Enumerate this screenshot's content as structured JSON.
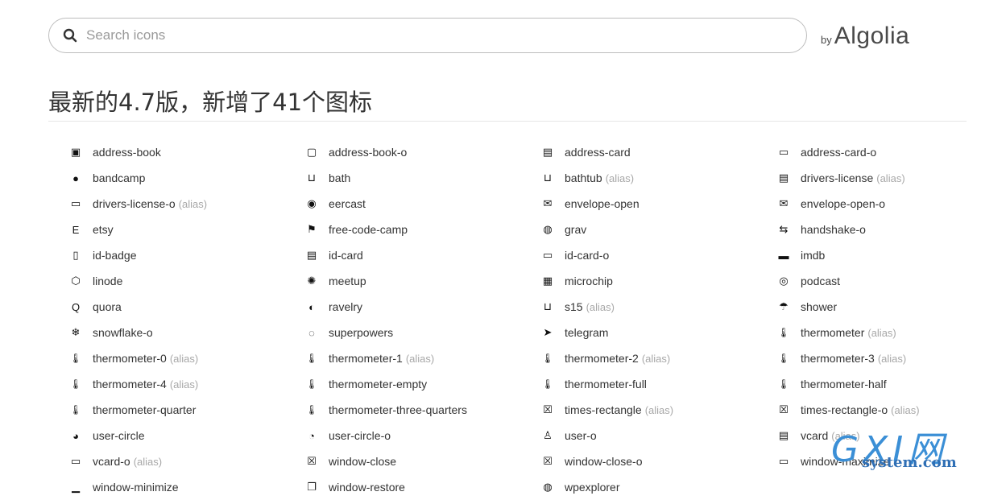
{
  "search": {
    "placeholder": "Search icons"
  },
  "branding": {
    "by": "by",
    "name": "Algolia"
  },
  "heading": "最新的4.7版，新增了41个图标",
  "icons": [
    {
      "name": "address-book",
      "alias": "",
      "icon": "address-book-icon"
    },
    {
      "name": "address-book-o",
      "alias": "",
      "icon": "address-book-outline-icon"
    },
    {
      "name": "address-card",
      "alias": "",
      "icon": "address-card-icon"
    },
    {
      "name": "address-card-o",
      "alias": "",
      "icon": "address-card-outline-icon"
    },
    {
      "name": "bandcamp",
      "alias": "",
      "icon": "bandcamp-icon"
    },
    {
      "name": "bath",
      "alias": "",
      "icon": "bath-icon"
    },
    {
      "name": "bathtub",
      "alias": "(alias)",
      "icon": "bathtub-icon"
    },
    {
      "name": "drivers-license",
      "alias": "(alias)",
      "icon": "drivers-license-icon"
    },
    {
      "name": "drivers-license-o",
      "alias": "(alias)",
      "icon": "drivers-license-outline-icon"
    },
    {
      "name": "eercast",
      "alias": "",
      "icon": "eercast-icon"
    },
    {
      "name": "envelope-open",
      "alias": "",
      "icon": "envelope-open-icon"
    },
    {
      "name": "envelope-open-o",
      "alias": "",
      "icon": "envelope-open-outline-icon"
    },
    {
      "name": "etsy",
      "alias": "",
      "icon": "etsy-icon"
    },
    {
      "name": "free-code-camp",
      "alias": "",
      "icon": "free-code-camp-icon"
    },
    {
      "name": "grav",
      "alias": "",
      "icon": "grav-icon"
    },
    {
      "name": "handshake-o",
      "alias": "",
      "icon": "handshake-icon"
    },
    {
      "name": "id-badge",
      "alias": "",
      "icon": "id-badge-icon"
    },
    {
      "name": "id-card",
      "alias": "",
      "icon": "id-card-icon"
    },
    {
      "name": "id-card-o",
      "alias": "",
      "icon": "id-card-outline-icon"
    },
    {
      "name": "imdb",
      "alias": "",
      "icon": "imdb-icon"
    },
    {
      "name": "linode",
      "alias": "",
      "icon": "linode-icon"
    },
    {
      "name": "meetup",
      "alias": "",
      "icon": "meetup-icon"
    },
    {
      "name": "microchip",
      "alias": "",
      "icon": "microchip-icon"
    },
    {
      "name": "podcast",
      "alias": "",
      "icon": "podcast-icon"
    },
    {
      "name": "quora",
      "alias": "",
      "icon": "quora-icon"
    },
    {
      "name": "ravelry",
      "alias": "",
      "icon": "ravelry-icon"
    },
    {
      "name": "s15",
      "alias": "(alias)",
      "icon": "s15-icon"
    },
    {
      "name": "shower",
      "alias": "",
      "icon": "shower-icon"
    },
    {
      "name": "snowflake-o",
      "alias": "",
      "icon": "snowflake-icon"
    },
    {
      "name": "superpowers",
      "alias": "",
      "icon": "superpowers-icon"
    },
    {
      "name": "telegram",
      "alias": "",
      "icon": "telegram-icon"
    },
    {
      "name": "thermometer",
      "alias": "(alias)",
      "icon": "thermometer-icon"
    },
    {
      "name": "thermometer-0",
      "alias": "(alias)",
      "icon": "thermometer-icon"
    },
    {
      "name": "thermometer-1",
      "alias": "(alias)",
      "icon": "thermometer-icon"
    },
    {
      "name": "thermometer-2",
      "alias": "(alias)",
      "icon": "thermometer-icon"
    },
    {
      "name": "thermometer-3",
      "alias": "(alias)",
      "icon": "thermometer-icon"
    },
    {
      "name": "thermometer-4",
      "alias": "(alias)",
      "icon": "thermometer-icon"
    },
    {
      "name": "thermometer-empty",
      "alias": "",
      "icon": "thermometer-icon"
    },
    {
      "name": "thermometer-full",
      "alias": "",
      "icon": "thermometer-icon"
    },
    {
      "name": "thermometer-half",
      "alias": "",
      "icon": "thermometer-icon"
    },
    {
      "name": "thermometer-quarter",
      "alias": "",
      "icon": "thermometer-icon"
    },
    {
      "name": "thermometer-three-quarters",
      "alias": "",
      "icon": "thermometer-icon"
    },
    {
      "name": "times-rectangle",
      "alias": "(alias)",
      "icon": "times-rectangle-icon"
    },
    {
      "name": "times-rectangle-o",
      "alias": "(alias)",
      "icon": "times-rectangle-outline-icon"
    },
    {
      "name": "user-circle",
      "alias": "",
      "icon": "user-circle-icon"
    },
    {
      "name": "user-circle-o",
      "alias": "",
      "icon": "user-circle-outline-icon"
    },
    {
      "name": "user-o",
      "alias": "",
      "icon": "user-outline-icon"
    },
    {
      "name": "vcard",
      "alias": "(alias)",
      "icon": "vcard-icon"
    },
    {
      "name": "vcard-o",
      "alias": "(alias)",
      "icon": "vcard-outline-icon"
    },
    {
      "name": "window-close",
      "alias": "",
      "icon": "window-close-icon"
    },
    {
      "name": "window-close-o",
      "alias": "",
      "icon": "window-close-outline-icon"
    },
    {
      "name": "window-maximize",
      "alias": "",
      "icon": "window-maximize-icon"
    },
    {
      "name": "window-minimize",
      "alias": "",
      "icon": "window-minimize-icon"
    },
    {
      "name": "window-restore",
      "alias": "",
      "icon": "window-restore-icon"
    },
    {
      "name": "wpexplorer",
      "alias": "",
      "icon": "wpexplorer-icon"
    }
  ],
  "watermark": {
    "logo": "GXI网",
    "site": "system.com"
  }
}
